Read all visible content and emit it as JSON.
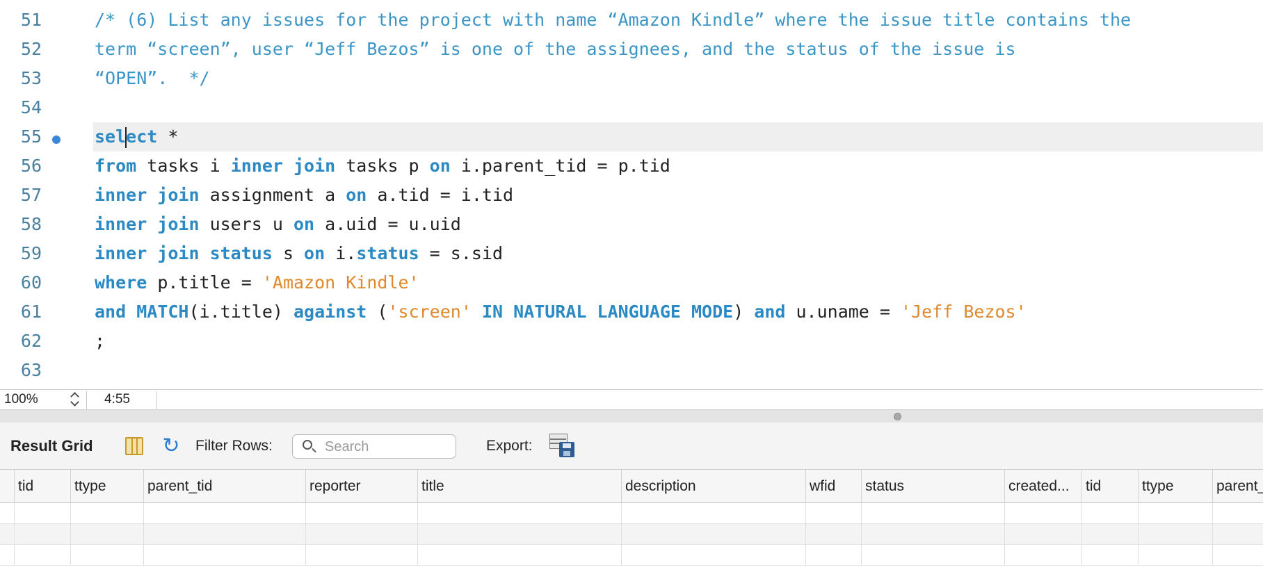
{
  "editor": {
    "lines": [
      {
        "num": "51",
        "segments": [
          {
            "t": "/* (6) List any issues for the project with name “Amazon Kindle” where the issue title contains the",
            "c": "cmt"
          }
        ]
      },
      {
        "num": "52",
        "segments": [
          {
            "t": "term “screen”, user “Jeff Bezos” is one of the assignees, and the status of the issue is",
            "c": "cmt"
          }
        ]
      },
      {
        "num": "53",
        "segments": [
          {
            "t": "“OPEN”.  */",
            "c": "cmt"
          }
        ]
      },
      {
        "num": "54",
        "segments": []
      },
      {
        "num": "55",
        "current": true,
        "segments": [
          {
            "t": "sel",
            "c": "kw"
          },
          {
            "caret": true
          },
          {
            "t": "ect",
            "c": "kw"
          },
          {
            "t": " *",
            "c": ""
          }
        ]
      },
      {
        "num": "56",
        "segments": [
          {
            "t": "from",
            "c": "kw"
          },
          {
            "t": " tasks i ",
            "c": ""
          },
          {
            "t": "inner join",
            "c": "kw"
          },
          {
            "t": " tasks p ",
            "c": ""
          },
          {
            "t": "on",
            "c": "kw"
          },
          {
            "t": " i.parent_tid = p.tid",
            "c": ""
          }
        ]
      },
      {
        "num": "57",
        "segments": [
          {
            "t": "inner join",
            "c": "kw"
          },
          {
            "t": " assignment a ",
            "c": ""
          },
          {
            "t": "on",
            "c": "kw"
          },
          {
            "t": " a.tid = i.tid",
            "c": ""
          }
        ]
      },
      {
        "num": "58",
        "segments": [
          {
            "t": "inner join",
            "c": "kw"
          },
          {
            "t": " users u ",
            "c": ""
          },
          {
            "t": "on",
            "c": "kw"
          },
          {
            "t": " a.uid = u.uid",
            "c": ""
          }
        ]
      },
      {
        "num": "59",
        "segments": [
          {
            "t": "inner join",
            "c": "kw"
          },
          {
            "t": " ",
            "c": ""
          },
          {
            "t": "status",
            "c": "kw"
          },
          {
            "t": " s ",
            "c": ""
          },
          {
            "t": "on",
            "c": "kw"
          },
          {
            "t": " i.",
            "c": ""
          },
          {
            "t": "status",
            "c": "kw"
          },
          {
            "t": " = s.sid",
            "c": ""
          }
        ]
      },
      {
        "num": "60",
        "segments": [
          {
            "t": "where",
            "c": "kw"
          },
          {
            "t": " p.title = ",
            "c": ""
          },
          {
            "t": "'Amazon Kindle'",
            "c": "str"
          }
        ]
      },
      {
        "num": "61",
        "segments": [
          {
            "t": "and",
            "c": "kw"
          },
          {
            "t": " ",
            "c": ""
          },
          {
            "t": "MATCH",
            "c": "kw"
          },
          {
            "t": "(i.title) ",
            "c": ""
          },
          {
            "t": "against",
            "c": "kw"
          },
          {
            "t": " (",
            "c": ""
          },
          {
            "t": "'screen'",
            "c": "str"
          },
          {
            "t": " ",
            "c": ""
          },
          {
            "t": "IN NATURAL LANGUAGE MODE",
            "c": "kw"
          },
          {
            "t": ") ",
            "c": ""
          },
          {
            "t": "and",
            "c": "kw"
          },
          {
            "t": " u.uname = ",
            "c": ""
          },
          {
            "t": "'Jeff Bezos'",
            "c": "str"
          }
        ]
      },
      {
        "num": "62",
        "segments": [
          {
            "t": ";",
            "c": ""
          }
        ]
      },
      {
        "num": "63",
        "segments": []
      }
    ]
  },
  "statusbar": {
    "zoom": "100%",
    "cursor_position": "4:55"
  },
  "result": {
    "title": "Result Grid",
    "filter_label": "Filter Rows:",
    "search_placeholder": "Search",
    "export_label": "Export:",
    "columns": [
      "tid",
      "ttype",
      "parent_tid",
      "reporter",
      "title",
      "description",
      "wfid",
      "status",
      "created...",
      "tid",
      "ttype",
      "parent_"
    ]
  },
  "icons": {
    "grid_toggle": "grid-icon",
    "refresh": "refresh-icon",
    "search": "search-icon",
    "export": "export-icon"
  },
  "colors": {
    "keyword": "#2b8ac4",
    "string": "#de8a2c",
    "comment": "#3b96c7",
    "line_number": "#4a7f9e"
  }
}
